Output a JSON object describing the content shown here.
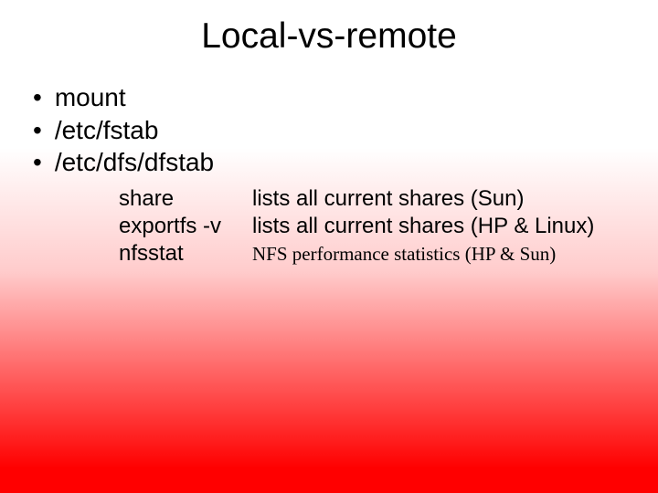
{
  "slide": {
    "title": "Local-vs-remote",
    "bullets": [
      "mount",
      "/etc/fstab",
      "/etc/dfs/dfstab"
    ],
    "commands": [
      {
        "name": "share",
        "desc": "lists all current shares (Sun)"
      },
      {
        "name": "exportfs -v",
        "desc": "lists all current shares (HP & Linux)"
      },
      {
        "name": "nfsstat",
        "desc": "NFS performance statistics (HP & Sun)"
      }
    ]
  }
}
